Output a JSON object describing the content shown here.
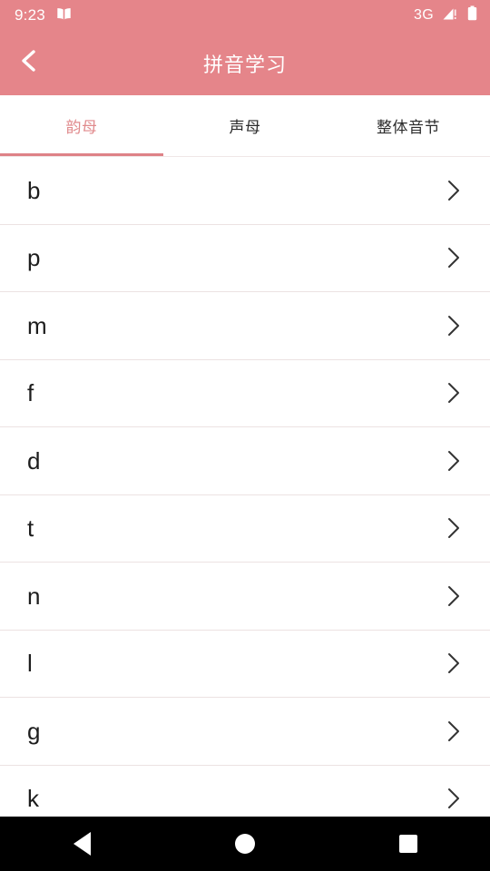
{
  "status_bar": {
    "time": "9:23",
    "app_icon": "book-icon",
    "network_type": "3G",
    "signal_icon": "signal-warning-icon",
    "battery_icon": "battery-icon"
  },
  "header": {
    "back_icon": "chevron-left-icon",
    "title": "拼音学习",
    "background_color": "#E5858A",
    "title_color": "#FFFFFF"
  },
  "tabs": {
    "active_index": 0,
    "accent_color": "#DE8287",
    "items": [
      {
        "label": "韵母",
        "active": true
      },
      {
        "label": "声母",
        "active": false
      },
      {
        "label": "整体音节",
        "active": false
      }
    ]
  },
  "list": {
    "chevron_icon": "chevron-right-icon",
    "items": [
      {
        "label": "b"
      },
      {
        "label": "p"
      },
      {
        "label": "m"
      },
      {
        "label": "f"
      },
      {
        "label": "d"
      },
      {
        "label": "t"
      },
      {
        "label": "n"
      },
      {
        "label": "l"
      },
      {
        "label": "g"
      },
      {
        "label": "k"
      }
    ]
  },
  "nav_bar": {
    "back_icon": "triangle-back-icon",
    "home_icon": "circle-home-icon",
    "recents_icon": "square-recents-icon"
  }
}
